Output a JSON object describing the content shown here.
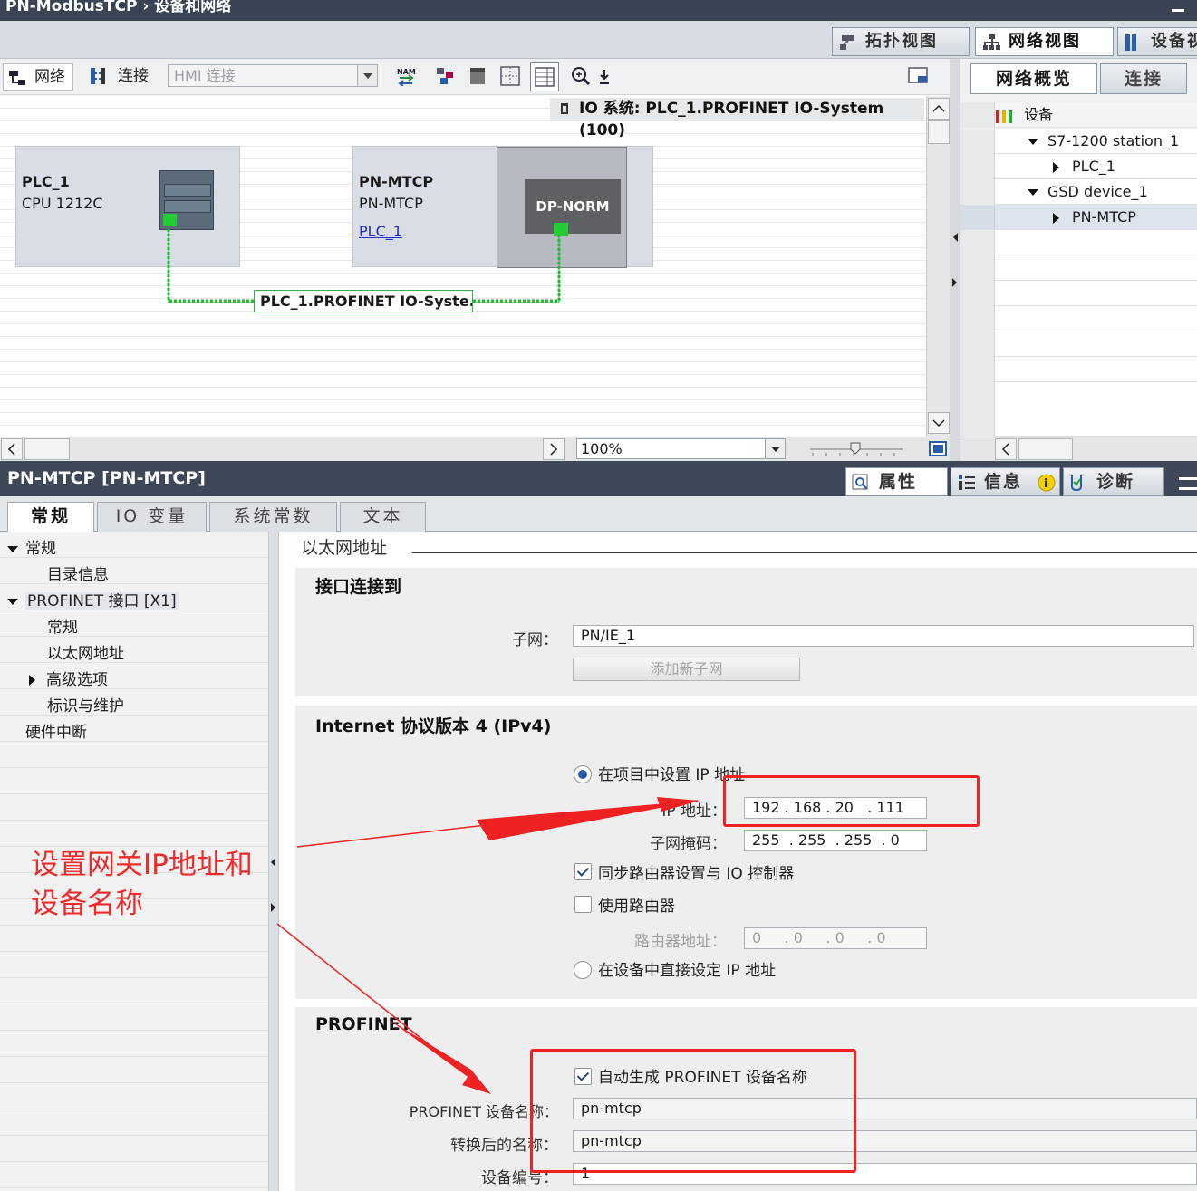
{
  "window": {
    "title": "PN-ModbusTCP  ›  设备和网络"
  },
  "view_tabs": [
    {
      "label": "拓扑视图",
      "icon": "topology-view-icon"
    },
    {
      "label": "网络视图",
      "icon": "network-view-icon"
    },
    {
      "label": "设备视",
      "icon": "device-view-icon"
    }
  ],
  "toolbar": {
    "network_label": "网络",
    "connections_label": "连接",
    "hmi_select": "HMI 连接"
  },
  "io_system_banner": "IO 系统: PLC_1.PROFINET IO-System (100)",
  "devices": [
    {
      "name": "PLC_1",
      "type": "CPU 1212C"
    },
    {
      "name": "PN-MTCP",
      "type": "PN-MTCP",
      "assigned_link": "PLC_1",
      "module_label": "DP-NORM"
    }
  ],
  "network_label": "PLC_1.PROFINET  IO-Syste...",
  "zoom": "100%",
  "right_panel": {
    "tabs": [
      "网络概览",
      "连接"
    ],
    "header": "设备",
    "tree": [
      {
        "label": "S7-1200 station_1",
        "level": 0,
        "expanded": true
      },
      {
        "label": "PLC_1",
        "level": 1,
        "expanded": false
      },
      {
        "label": "GSD device_1",
        "level": 0,
        "expanded": true
      },
      {
        "label": "PN-MTCP",
        "level": 1,
        "expanded": false
      }
    ]
  },
  "inspector": {
    "title": "PN-MTCP [PN-MTCP]",
    "tabs": [
      "属性",
      "信息",
      "诊断"
    ],
    "prop_tabs": [
      "常规",
      "IO 变量",
      "系统常数",
      "文本"
    ],
    "nav": [
      "常规",
      "目录信息",
      "PROFINET 接口 [X1]",
      "常规",
      "以太网地址",
      "高级选项",
      "标识与维护",
      "硬件中断"
    ]
  },
  "ethernet": {
    "heading": "以太网地址",
    "interface_section": "接口连接到",
    "subnet_label": "子网：",
    "subnet_value": "PN/IE_1",
    "add_subnet": "添加新子网",
    "ipv4_section": "Internet 协议版本 4 (IPv4)",
    "set_in_project": "在项目中设置 IP 地址",
    "ip_label": "IP 地址：",
    "ip_value": "192 . 168 . 20   . 111",
    "mask_label": "子网掩码：",
    "mask_value": "255  . 255  . 255  . 0",
    "sync_router": "同步路由器设置与 IO 控制器",
    "use_router": "使用路由器",
    "router_label": "路由器地址：",
    "router_value": "0     . 0     . 0     . 0",
    "set_on_device": "在设备中直接设定 IP 地址",
    "profinet_section": "PROFINET",
    "auto_name": "自动生成 PROFINET 设备名称",
    "dev_name_label": "PROFINET 设备名称：",
    "dev_name_value": "pn-mtcp",
    "converted_label": "转换后的名称：",
    "converted_value": "pn-mtcp",
    "dev_num_label": "设备编号：",
    "dev_num_value": "1"
  },
  "annotation": {
    "text": "设置网关IP地址和设备名称",
    "color": "#ee2a2a"
  }
}
